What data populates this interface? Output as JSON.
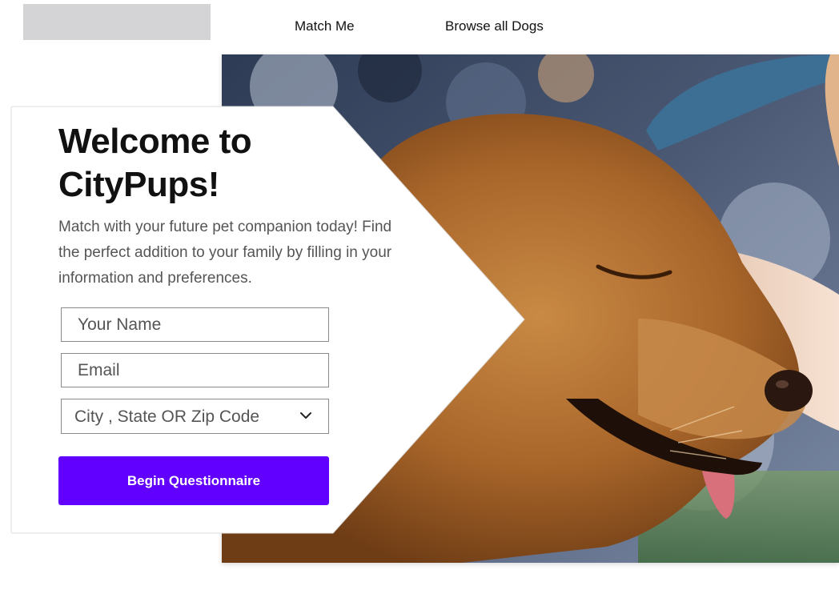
{
  "nav": {
    "links": [
      "Match Me",
      "Browse all Dogs"
    ]
  },
  "hero": {
    "image_subject": "golden retriever being petted"
  },
  "card": {
    "title_line1": "Welcome to",
    "title_line2": "CityPups!",
    "subtitle": "Match with your future pet companion today! Find the perfect addition to your family by filling in your information and preferences."
  },
  "form": {
    "name_placeholder": "Your Name",
    "email_placeholder": "Email",
    "location_selected": "City , State OR Zip Code",
    "submit_label": "Begin Questionnaire"
  },
  "colors": {
    "accent": "#6200ff",
    "logo_placeholder": "#d4d4d6"
  },
  "icons": {
    "dropdown": "chevron-down-icon"
  }
}
